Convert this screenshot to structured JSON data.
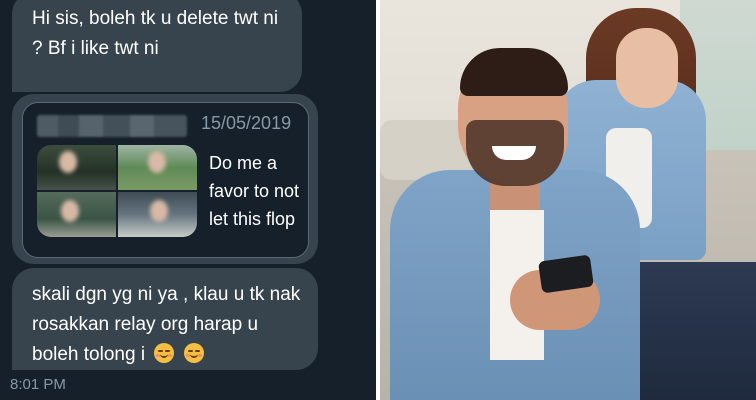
{
  "chat": {
    "messages": [
      {
        "text": "Hi sis, boleh tk u delete twt ni ? Bf i like twt ni"
      },
      {
        "text": "skali dgn yg ni ya , klau u tk nak rosakkan relay org harap u boleh tolong i"
      }
    ],
    "quoted_tweet": {
      "date": "15/05/2019",
      "text": "Do me a favor to not let this flop"
    },
    "timestamp": "8:01 PM",
    "emoji": [
      "smiling-face-icon",
      "smiling-face-icon"
    ],
    "colors": {
      "background": "#15202b",
      "bubble": "#38444d",
      "muted_text": "#8899a6"
    }
  },
  "photo": {
    "subject": "stock-photo"
  }
}
